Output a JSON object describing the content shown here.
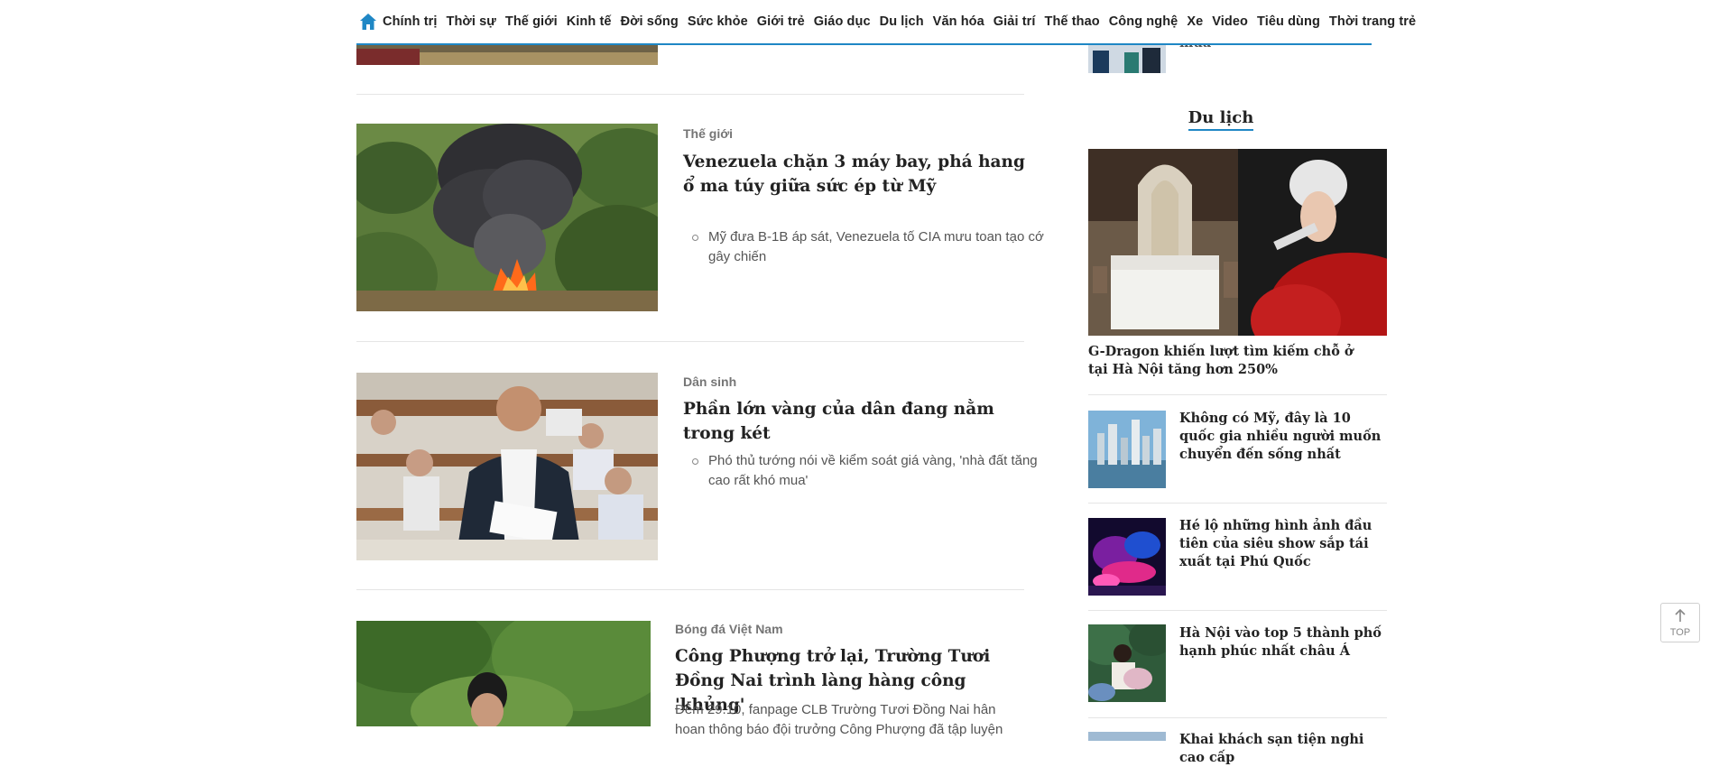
{
  "nav": {
    "home_icon": "home-icon",
    "items": [
      "Chính trị",
      "Thời sự",
      "Thế giới",
      "Kinh tế",
      "Đời sống",
      "Sức khỏe",
      "Giới trẻ",
      "Giáo dục",
      "Du lịch",
      "Văn hóa",
      "Giải trí",
      "Thế thao",
      "Công nghệ",
      "Xe",
      "Video",
      "Tiêu dùng",
      "Thời trang trẻ"
    ]
  },
  "articles": [
    {
      "category": "Thế giới",
      "title": "Venezuela chặn 3 máy bay, phá hang ổ ma túy giữa sức ép từ Mỹ",
      "related": "Mỹ đưa B-1B áp sát, Venezuela tố CIA mưu toan tạo cớ gây chiến"
    },
    {
      "category": "Dân sinh",
      "title": "Phần lớn vàng của dân đang nằm trong két",
      "related": "Phó thủ tướng nói về kiểm soát giá vàng, 'nhà đất tăng cao rất khó mua'"
    },
    {
      "category": "Bóng đá Việt Nam",
      "title": "Công Phượng trở lại, Trường Tươi Đồng Nai trình làng hàng công 'khủng'",
      "sapo": "Đêm 29.10, fanpage CLB Trường Tươi Đồng Nai hân hoan thông báo đội trưởng Công Phượng đã tập luyện"
    }
  ],
  "sidebar": {
    "section_title": "Du lịch",
    "top_partial_title": "mua",
    "featured_title": "G-Dragon khiến lượt tìm kiếm chỗ ở tại Hà Nội tăng hơn 250%",
    "items": [
      {
        "title": "Không có Mỹ, đây là 10 quốc gia nhiều người muốn chuyển đến sống nhất"
      },
      {
        "title": "Hé lộ những hình ảnh đầu tiên của siêu show sắp tái xuất tại Phú Quốc"
      },
      {
        "title": "Hà Nội vào top 5 thành phố hạnh phúc nhất châu Á"
      },
      {
        "title": "Khai khách sạn tiện nghi cao cấp"
      }
    ]
  },
  "top_button": {
    "label": "TOP",
    "icon": "arrow-up-icon"
  },
  "colors": {
    "accent": "#1f87c5",
    "text": "#222222",
    "muted": "#757575"
  }
}
